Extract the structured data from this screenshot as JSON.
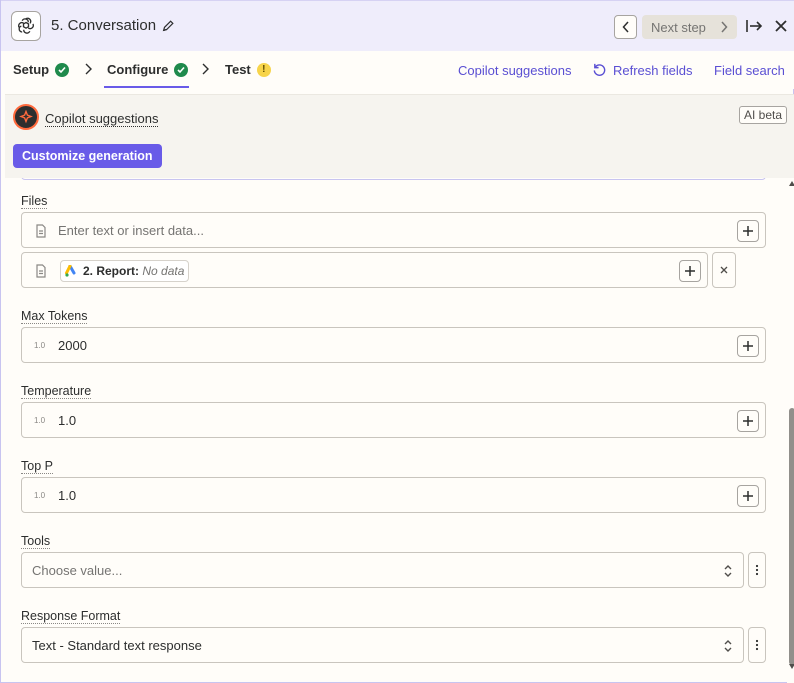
{
  "header": {
    "title": "5. Conversation",
    "next_label": "Next step",
    "app_icon": "openai-icon"
  },
  "tabs": [
    {
      "label": "Setup",
      "status": "complete"
    },
    {
      "label": "Configure",
      "status": "complete",
      "active": true
    },
    {
      "label": "Test",
      "status": "warning"
    }
  ],
  "tab_links": {
    "copilot": "Copilot suggestions",
    "refresh": "Refresh fields",
    "field_search": "Field search"
  },
  "copilot": {
    "title": "Copilot suggestions",
    "badge": "AI beta",
    "customize": "Customize generation"
  },
  "fields": {
    "files": {
      "label": "Files",
      "placeholder": "Enter text or insert data...",
      "pill_step": "2. Report:",
      "pill_value": "No data"
    },
    "max_tokens": {
      "label": "Max Tokens",
      "value": "2000",
      "type_hint": "1.0"
    },
    "temperature": {
      "label": "Temperature",
      "value": "1.0",
      "type_hint": "1.0"
    },
    "top_p": {
      "label": "Top P",
      "value": "1.0",
      "type_hint": "1.0"
    },
    "tools": {
      "label": "Tools",
      "placeholder": "Choose value..."
    },
    "response_format": {
      "label": "Response Format",
      "value": "Text - Standard text response"
    }
  },
  "colors": {
    "accent": "#695be8",
    "header_bg": "#efedfb",
    "success": "#1f8a4c",
    "warning": "#f7d44a"
  }
}
